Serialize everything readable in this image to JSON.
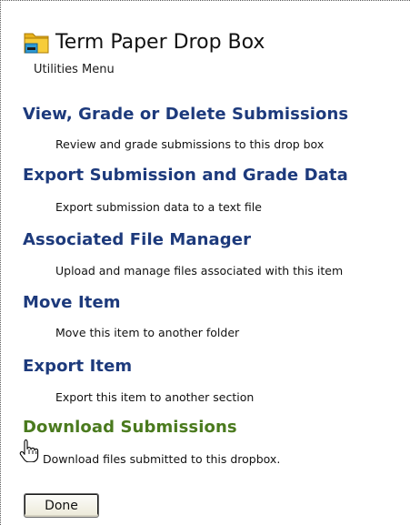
{
  "header": {
    "title": "Term Paper Drop Box",
    "icon": "dropbox-folder-icon"
  },
  "utilities_label": "Utilities Menu",
  "items": [
    {
      "label": "View, Grade or Delete Submissions",
      "description": "Review and grade submissions to this drop box"
    },
    {
      "label": "Export Submission and Grade Data",
      "description": "Export submission data to a text file"
    },
    {
      "label": "Associated File Manager",
      "description": "Upload and manage files associated with this item"
    },
    {
      "label": "Move Item",
      "description": "Move this item to another folder"
    },
    {
      "label": "Export Item",
      "description": "Export this item to another section"
    },
    {
      "label": "Download Submissions",
      "description": "Download files submitted to this dropbox."
    }
  ],
  "done_label": "Done",
  "colors": {
    "link": "#1d3a7c",
    "active_link": "#4a7a1e"
  }
}
